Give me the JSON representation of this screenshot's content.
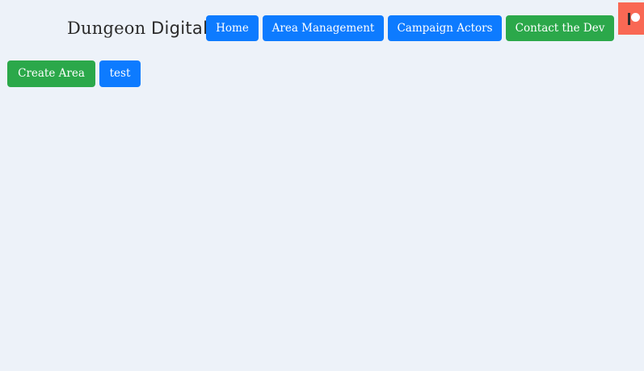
{
  "header": {
    "brand_word1": "Dungeon",
    "brand_word2": "Digital",
    "nav": {
      "home": "Home",
      "area_management": "Area Management",
      "campaign_actors": "Campaign Actors",
      "contact_dev": "Contact the Dev"
    },
    "patreon_icon": "patreon-icon"
  },
  "main": {
    "create_area_label": "Create Area",
    "areas": [
      "test"
    ]
  },
  "colors": {
    "primary": "#0d7bff",
    "success": "#2ba84a",
    "patreon": "#f96854",
    "background": "#edf2f9"
  }
}
